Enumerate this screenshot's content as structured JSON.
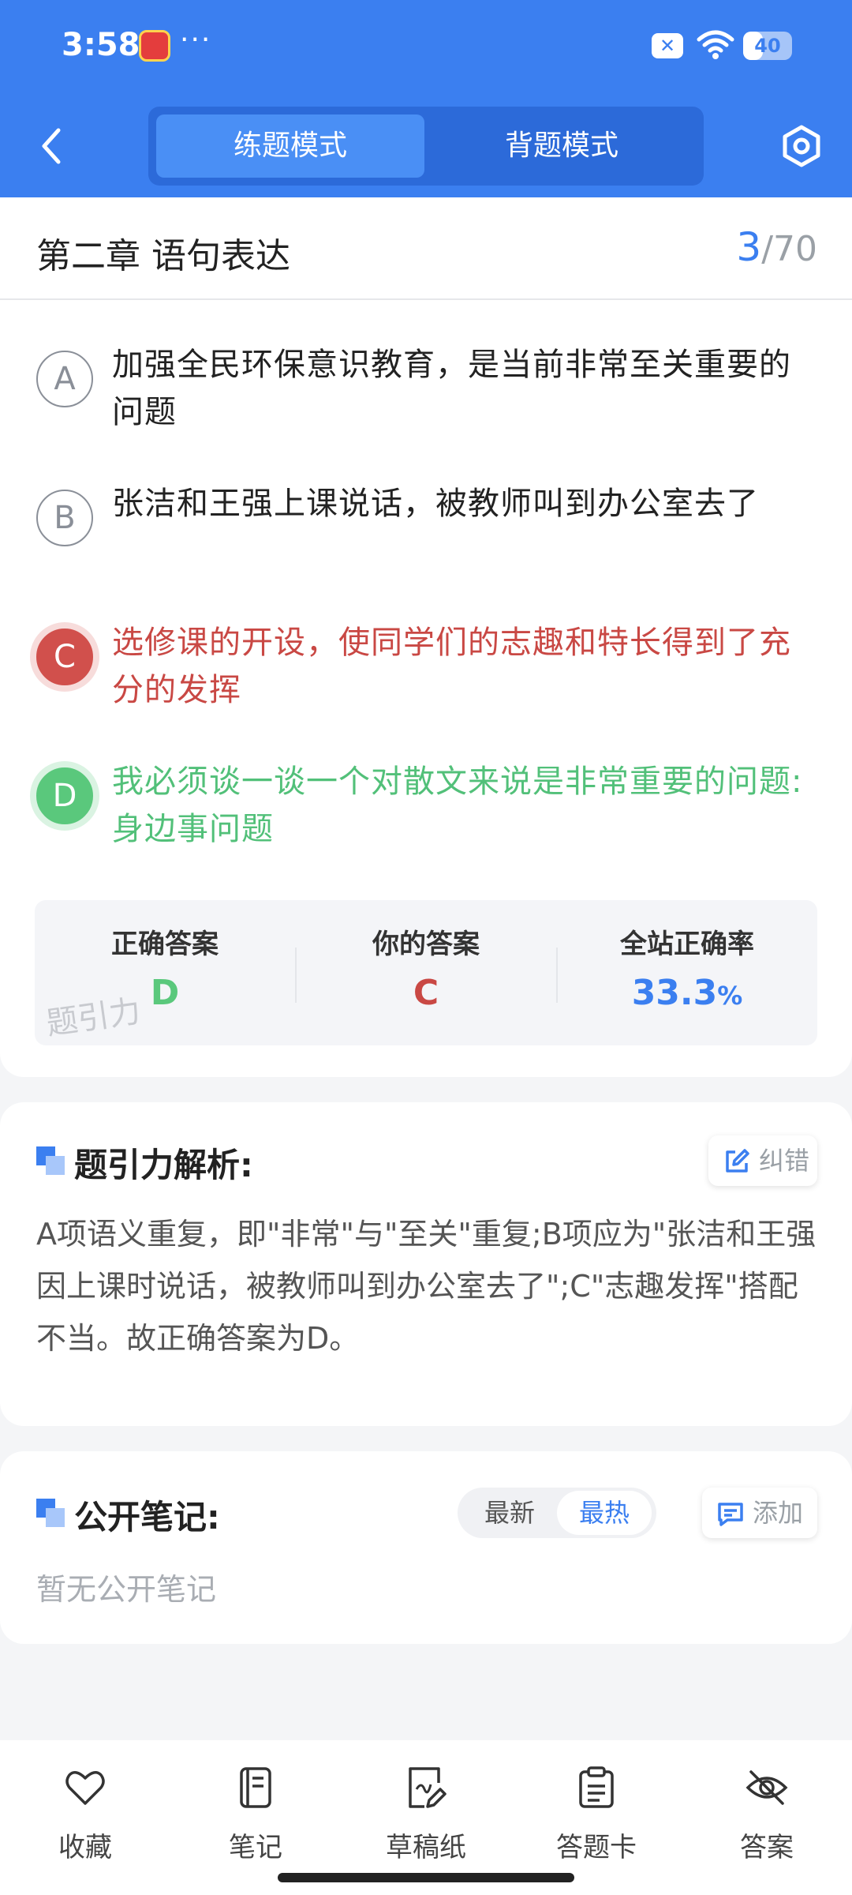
{
  "status_bar": {
    "time": "3:58",
    "more": "···",
    "battery": "40",
    "battery_level": 0.4
  },
  "header": {
    "modes": [
      "练题模式",
      "背题模式"
    ],
    "active_mode": "练题模式"
  },
  "chapter": {
    "title": "第二章 语句表达",
    "current": "3",
    "total": "/70"
  },
  "options": [
    {
      "letter": "A",
      "text": "加强全民环保意识教育，是当前非常至关重要的问题",
      "state": "normal"
    },
    {
      "letter": "B",
      "text": "张洁和王强上课说话，被教师叫到办公室去了",
      "state": "normal"
    },
    {
      "letter": "C",
      "text": "选修课的开设，使同学们的志趣和特长得到了充分的发挥",
      "state": "wrong"
    },
    {
      "letter": "D",
      "text": "我必须谈一谈一个对散文来说是非常重要的问题:身边事问题",
      "state": "correct"
    }
  ],
  "stats": {
    "correct_label": "正确答案",
    "correct_value": "D",
    "yours_label": "你的答案",
    "yours_value": "C",
    "rate_label": "全站正确率",
    "rate_value": "33.3",
    "rate_unit": "%"
  },
  "watermark": "题引力",
  "analysis": {
    "title": "题引力解析:",
    "report_label": "纠错",
    "text": "A项语义重复，即\"非常\"与\"至关\"重复;B项应为\"张洁和王强因上课时说话，被教师叫到办公室去了\";C\"志趣发挥\"搭配不当。故正确答案为D。"
  },
  "notes": {
    "title": "公开笔记:",
    "sort_options": [
      "最新",
      "最热"
    ],
    "active_sort": "最热",
    "add_label": "添加",
    "empty_text": "暂无公开笔记"
  },
  "bottom_nav": [
    {
      "label": "收藏",
      "icon": "heart-icon"
    },
    {
      "label": "笔记",
      "icon": "notebook-icon"
    },
    {
      "label": "草稿纸",
      "icon": "draft-icon"
    },
    {
      "label": "答题卡",
      "icon": "clipboard-icon"
    },
    {
      "label": "答案",
      "icon": "eye-off-icon"
    }
  ],
  "colors": {
    "primary": "#3b7ff0",
    "wrong": "#d1504c",
    "correct": "#5ac87c"
  }
}
